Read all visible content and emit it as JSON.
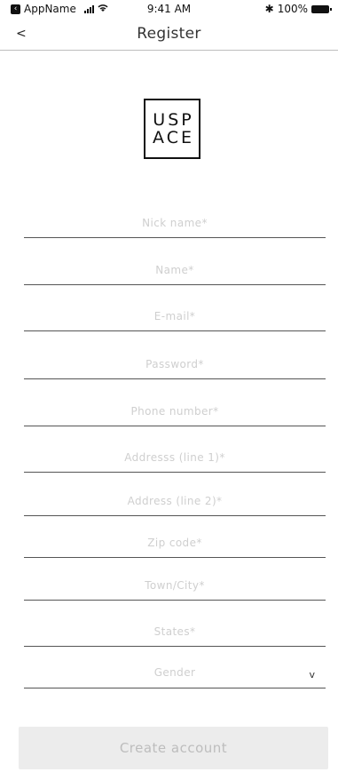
{
  "status_bar": {
    "app_name": "AppName",
    "time": "9:41 AM",
    "battery": "100%"
  },
  "nav": {
    "back_label": "<",
    "title": "Register"
  },
  "logo": {
    "line1": "USP",
    "line2": "ACE"
  },
  "form": {
    "nickname_placeholder": "Nick name*",
    "name_placeholder": "Name*",
    "email_placeholder": "E-mail*",
    "password_placeholder": "Password*",
    "phone_placeholder": "Phone number*",
    "address1_placeholder": "Addresss (line 1)*",
    "address2_placeholder": "Address (line 2)*",
    "zip_placeholder": "Zip code*",
    "city_placeholder": "Town/City*",
    "state_placeholder": "States*",
    "gender_label": "Gender",
    "gender_chevron": "v"
  },
  "submit": {
    "label": "Create account"
  }
}
